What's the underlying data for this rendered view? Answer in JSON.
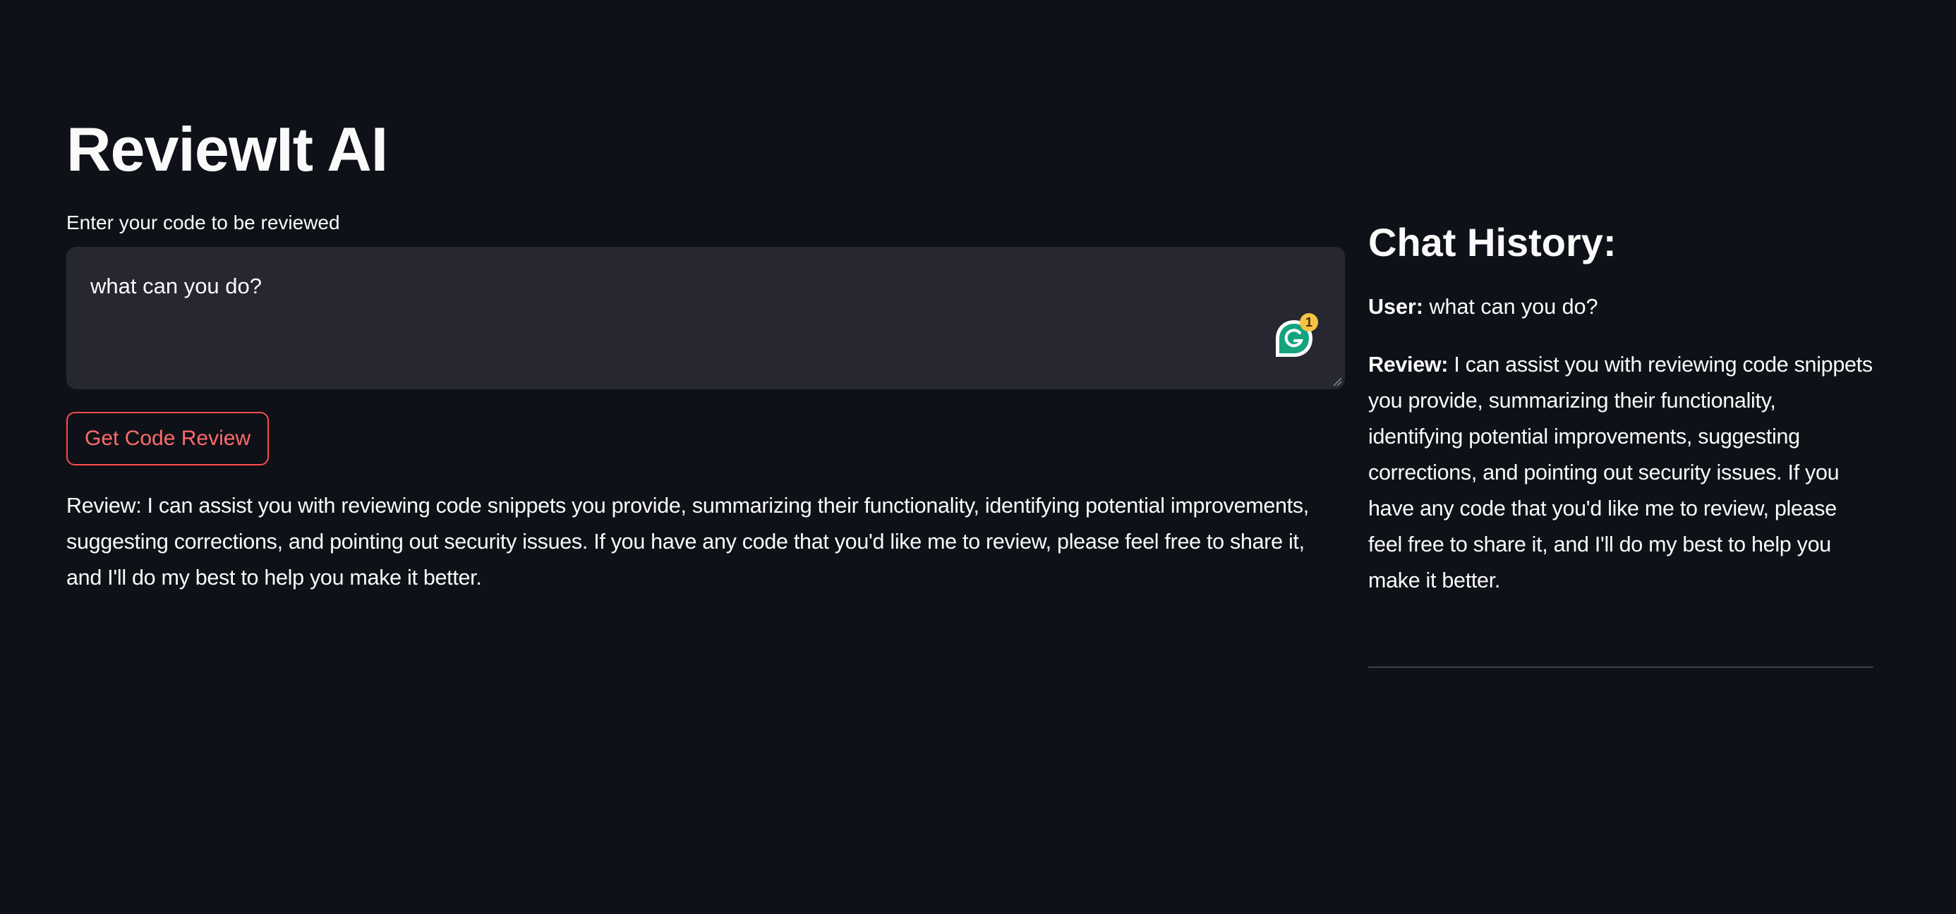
{
  "app": {
    "title": "ReviewIt AI"
  },
  "input": {
    "label": "Enter your code to be reviewed",
    "value": "what can you do?",
    "assistant_badge_count": "1"
  },
  "button": {
    "label": "Get Code Review"
  },
  "output": {
    "text": "Review: I can assist you with reviewing code snippets you provide, summarizing their functionality, identifying potential improvements, suggesting corrections, and pointing out security issues. If you have any code that you'd like me to review, please feel free to share it, and I'll do my best to help you make it better."
  },
  "chat_history": {
    "title": "Chat History:",
    "user_label": "User:",
    "user_message": "what can you do?",
    "review_label": "Review:",
    "review_message": "I can assist you with reviewing code snippets you provide, summarizing their functionality, identifying potential improvements, suggesting corrections, and pointing out security issues. If you have any code that you'd like me to review, please feel free to share it, and I'll do my best to help you make it better."
  },
  "colors": {
    "background": "#0e1117",
    "input_background": "#262730",
    "accent": "#ff4b4b",
    "text": "#fafafa"
  },
  "icons": {
    "assistant": "grammarly-icon",
    "resize": "resize-handle-icon"
  }
}
